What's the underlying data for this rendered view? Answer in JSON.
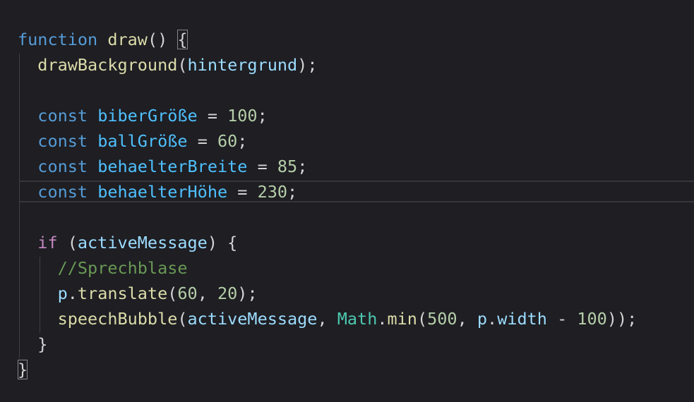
{
  "editor": {
    "lines": [
      [
        {
          "t": "function",
          "c": "kw"
        },
        {
          "t": " ",
          "c": "pun"
        },
        {
          "t": "draw",
          "c": "fn"
        },
        {
          "t": "() ",
          "c": "pun"
        },
        {
          "t": "{",
          "c": "pun bracket-match"
        }
      ],
      [
        {
          "t": "  ",
          "c": "pun"
        },
        {
          "t": "drawBackground",
          "c": "fn"
        },
        {
          "t": "(",
          "c": "pun"
        },
        {
          "t": "hintergrund",
          "c": "var"
        },
        {
          "t": ");",
          "c": "pun"
        }
      ],
      [],
      [
        {
          "t": "  ",
          "c": "pun"
        },
        {
          "t": "const",
          "c": "kw"
        },
        {
          "t": " ",
          "c": "pun"
        },
        {
          "t": "biberGröße",
          "c": "cvar"
        },
        {
          "t": " = ",
          "c": "pun"
        },
        {
          "t": "100",
          "c": "num"
        },
        {
          "t": ";",
          "c": "pun"
        }
      ],
      [
        {
          "t": "  ",
          "c": "pun"
        },
        {
          "t": "const",
          "c": "kw"
        },
        {
          "t": " ",
          "c": "pun"
        },
        {
          "t": "ballGröße",
          "c": "cvar"
        },
        {
          "t": " = ",
          "c": "pun"
        },
        {
          "t": "60",
          "c": "num"
        },
        {
          "t": ";",
          "c": "pun"
        }
      ],
      [
        {
          "t": "  ",
          "c": "pun"
        },
        {
          "t": "const",
          "c": "kw"
        },
        {
          "t": " ",
          "c": "pun"
        },
        {
          "t": "behaelterBreite",
          "c": "cvar"
        },
        {
          "t": " = ",
          "c": "pun"
        },
        {
          "t": "85",
          "c": "num"
        },
        {
          "t": ";",
          "c": "pun"
        }
      ],
      [
        {
          "t": "  ",
          "c": "pun"
        },
        {
          "t": "const",
          "c": "kw"
        },
        {
          "t": " ",
          "c": "pun"
        },
        {
          "t": "behaelterHöhe",
          "c": "cvar"
        },
        {
          "t": " = ",
          "c": "pun"
        },
        {
          "t": "230",
          "c": "num"
        },
        {
          "t": ";",
          "c": "pun"
        }
      ],
      [],
      [
        {
          "t": "  ",
          "c": "pun"
        },
        {
          "t": "if",
          "c": "kw2"
        },
        {
          "t": " (",
          "c": "pun"
        },
        {
          "t": "activeMessage",
          "c": "var"
        },
        {
          "t": ") {",
          "c": "pun"
        }
      ],
      [
        {
          "t": "    ",
          "c": "pun"
        },
        {
          "t": "//Sprechblase",
          "c": "cmt"
        }
      ],
      [
        {
          "t": "    ",
          "c": "pun"
        },
        {
          "t": "p",
          "c": "var"
        },
        {
          "t": ".",
          "c": "pun"
        },
        {
          "t": "translate",
          "c": "fn"
        },
        {
          "t": "(",
          "c": "pun"
        },
        {
          "t": "60",
          "c": "num"
        },
        {
          "t": ", ",
          "c": "pun"
        },
        {
          "t": "20",
          "c": "num"
        },
        {
          "t": ");",
          "c": "pun"
        }
      ],
      [
        {
          "t": "    ",
          "c": "pun"
        },
        {
          "t": "speechBubble",
          "c": "fn"
        },
        {
          "t": "(",
          "c": "pun"
        },
        {
          "t": "activeMessage",
          "c": "var"
        },
        {
          "t": ", ",
          "c": "pun"
        },
        {
          "t": "Math",
          "c": "cls"
        },
        {
          "t": ".",
          "c": "pun"
        },
        {
          "t": "min",
          "c": "fn"
        },
        {
          "t": "(",
          "c": "pun"
        },
        {
          "t": "500",
          "c": "num"
        },
        {
          "t": ", ",
          "c": "pun"
        },
        {
          "t": "p",
          "c": "var"
        },
        {
          "t": ".",
          "c": "pun"
        },
        {
          "t": "width",
          "c": "var"
        },
        {
          "t": " - ",
          "c": "pun"
        },
        {
          "t": "100",
          "c": "num"
        },
        {
          "t": "));",
          "c": "pun"
        }
      ],
      [
        {
          "t": "  }",
          "c": "pun"
        }
      ],
      [
        {
          "t": "}",
          "c": "pun bracket-match"
        }
      ]
    ],
    "current_line_index": 6,
    "colors": {
      "background": "#1e1e23",
      "keyword": "#569cd6",
      "control_keyword": "#c586c0",
      "function": "#dcdcaa",
      "variable": "#9cdcfe",
      "constant": "#4fc1ff",
      "class": "#4ec9b0",
      "number": "#b5cea8",
      "comment": "#6a9955",
      "punctuation": "#d4d4d4"
    }
  }
}
